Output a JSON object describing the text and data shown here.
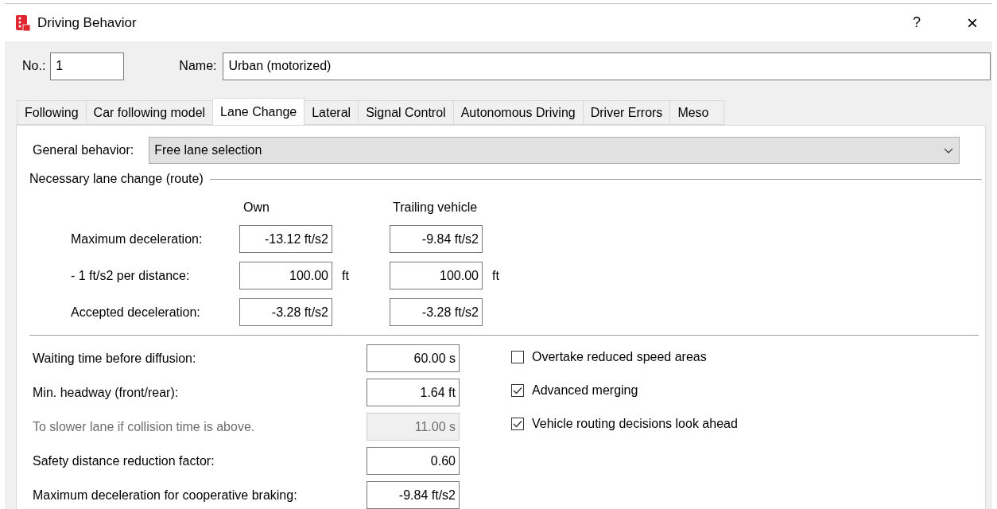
{
  "window": {
    "title": "Driving Behavior",
    "help": "?",
    "close": "×"
  },
  "header": {
    "number_label": "No.:",
    "number": "1",
    "name_label": "Name:",
    "name": "Urban (motorized)"
  },
  "tabs": [
    {
      "label": "Following",
      "selected": false
    },
    {
      "label": "Car following model",
      "selected": false
    },
    {
      "label": "Lane Change",
      "selected": true
    },
    {
      "label": "Lateral",
      "selected": false
    },
    {
      "label": "Signal Control",
      "selected": false
    },
    {
      "label": "Autonomous Driving",
      "selected": false
    },
    {
      "label": "Driver Errors",
      "selected": false
    },
    {
      "label": "Meso",
      "selected": false
    }
  ],
  "general_behavior": {
    "label": "General behavior:",
    "value": "Free lane selection"
  },
  "necessary_lane_change": {
    "title": "Necessary lane change (route)",
    "columns": [
      "Own",
      "Trailing vehicle"
    ],
    "rows": [
      {
        "label": "Maximum deceleration:",
        "own": "-13.12 ft/s2",
        "trailing": "-9.84 ft/s2"
      },
      {
        "label": "- 1 ft/s2 per distance:",
        "own": "100.00",
        "own_unit": "ft",
        "trailing": "100.00",
        "trailing_unit": "ft"
      },
      {
        "label": "Accepted deceleration:",
        "own": "-3.28 ft/s2",
        "trailing": "-3.28 ft/s2"
      }
    ]
  },
  "parameters": [
    {
      "label": "Waiting time before diffusion:",
      "value": "60.00 s",
      "disabled": false
    },
    {
      "label": "Min. headway (front/rear):",
      "value": "1.64 ft",
      "disabled": false
    },
    {
      "label": "To slower lane if collision time is above.",
      "value": "11.00 s",
      "disabled": true
    },
    {
      "label": "Safety distance reduction factor:",
      "value": "0.60",
      "disabled": false
    },
    {
      "label": "Maximum deceleration for cooperative braking:",
      "value": "-9.84 ft/s2",
      "disabled": false
    }
  ],
  "options": [
    {
      "label": "Overtake reduced speed areas",
      "checked": false
    },
    {
      "label": "Advanced merging",
      "checked": true
    },
    {
      "label": "Vehicle routing decisions look ahead",
      "checked": true
    }
  ]
}
